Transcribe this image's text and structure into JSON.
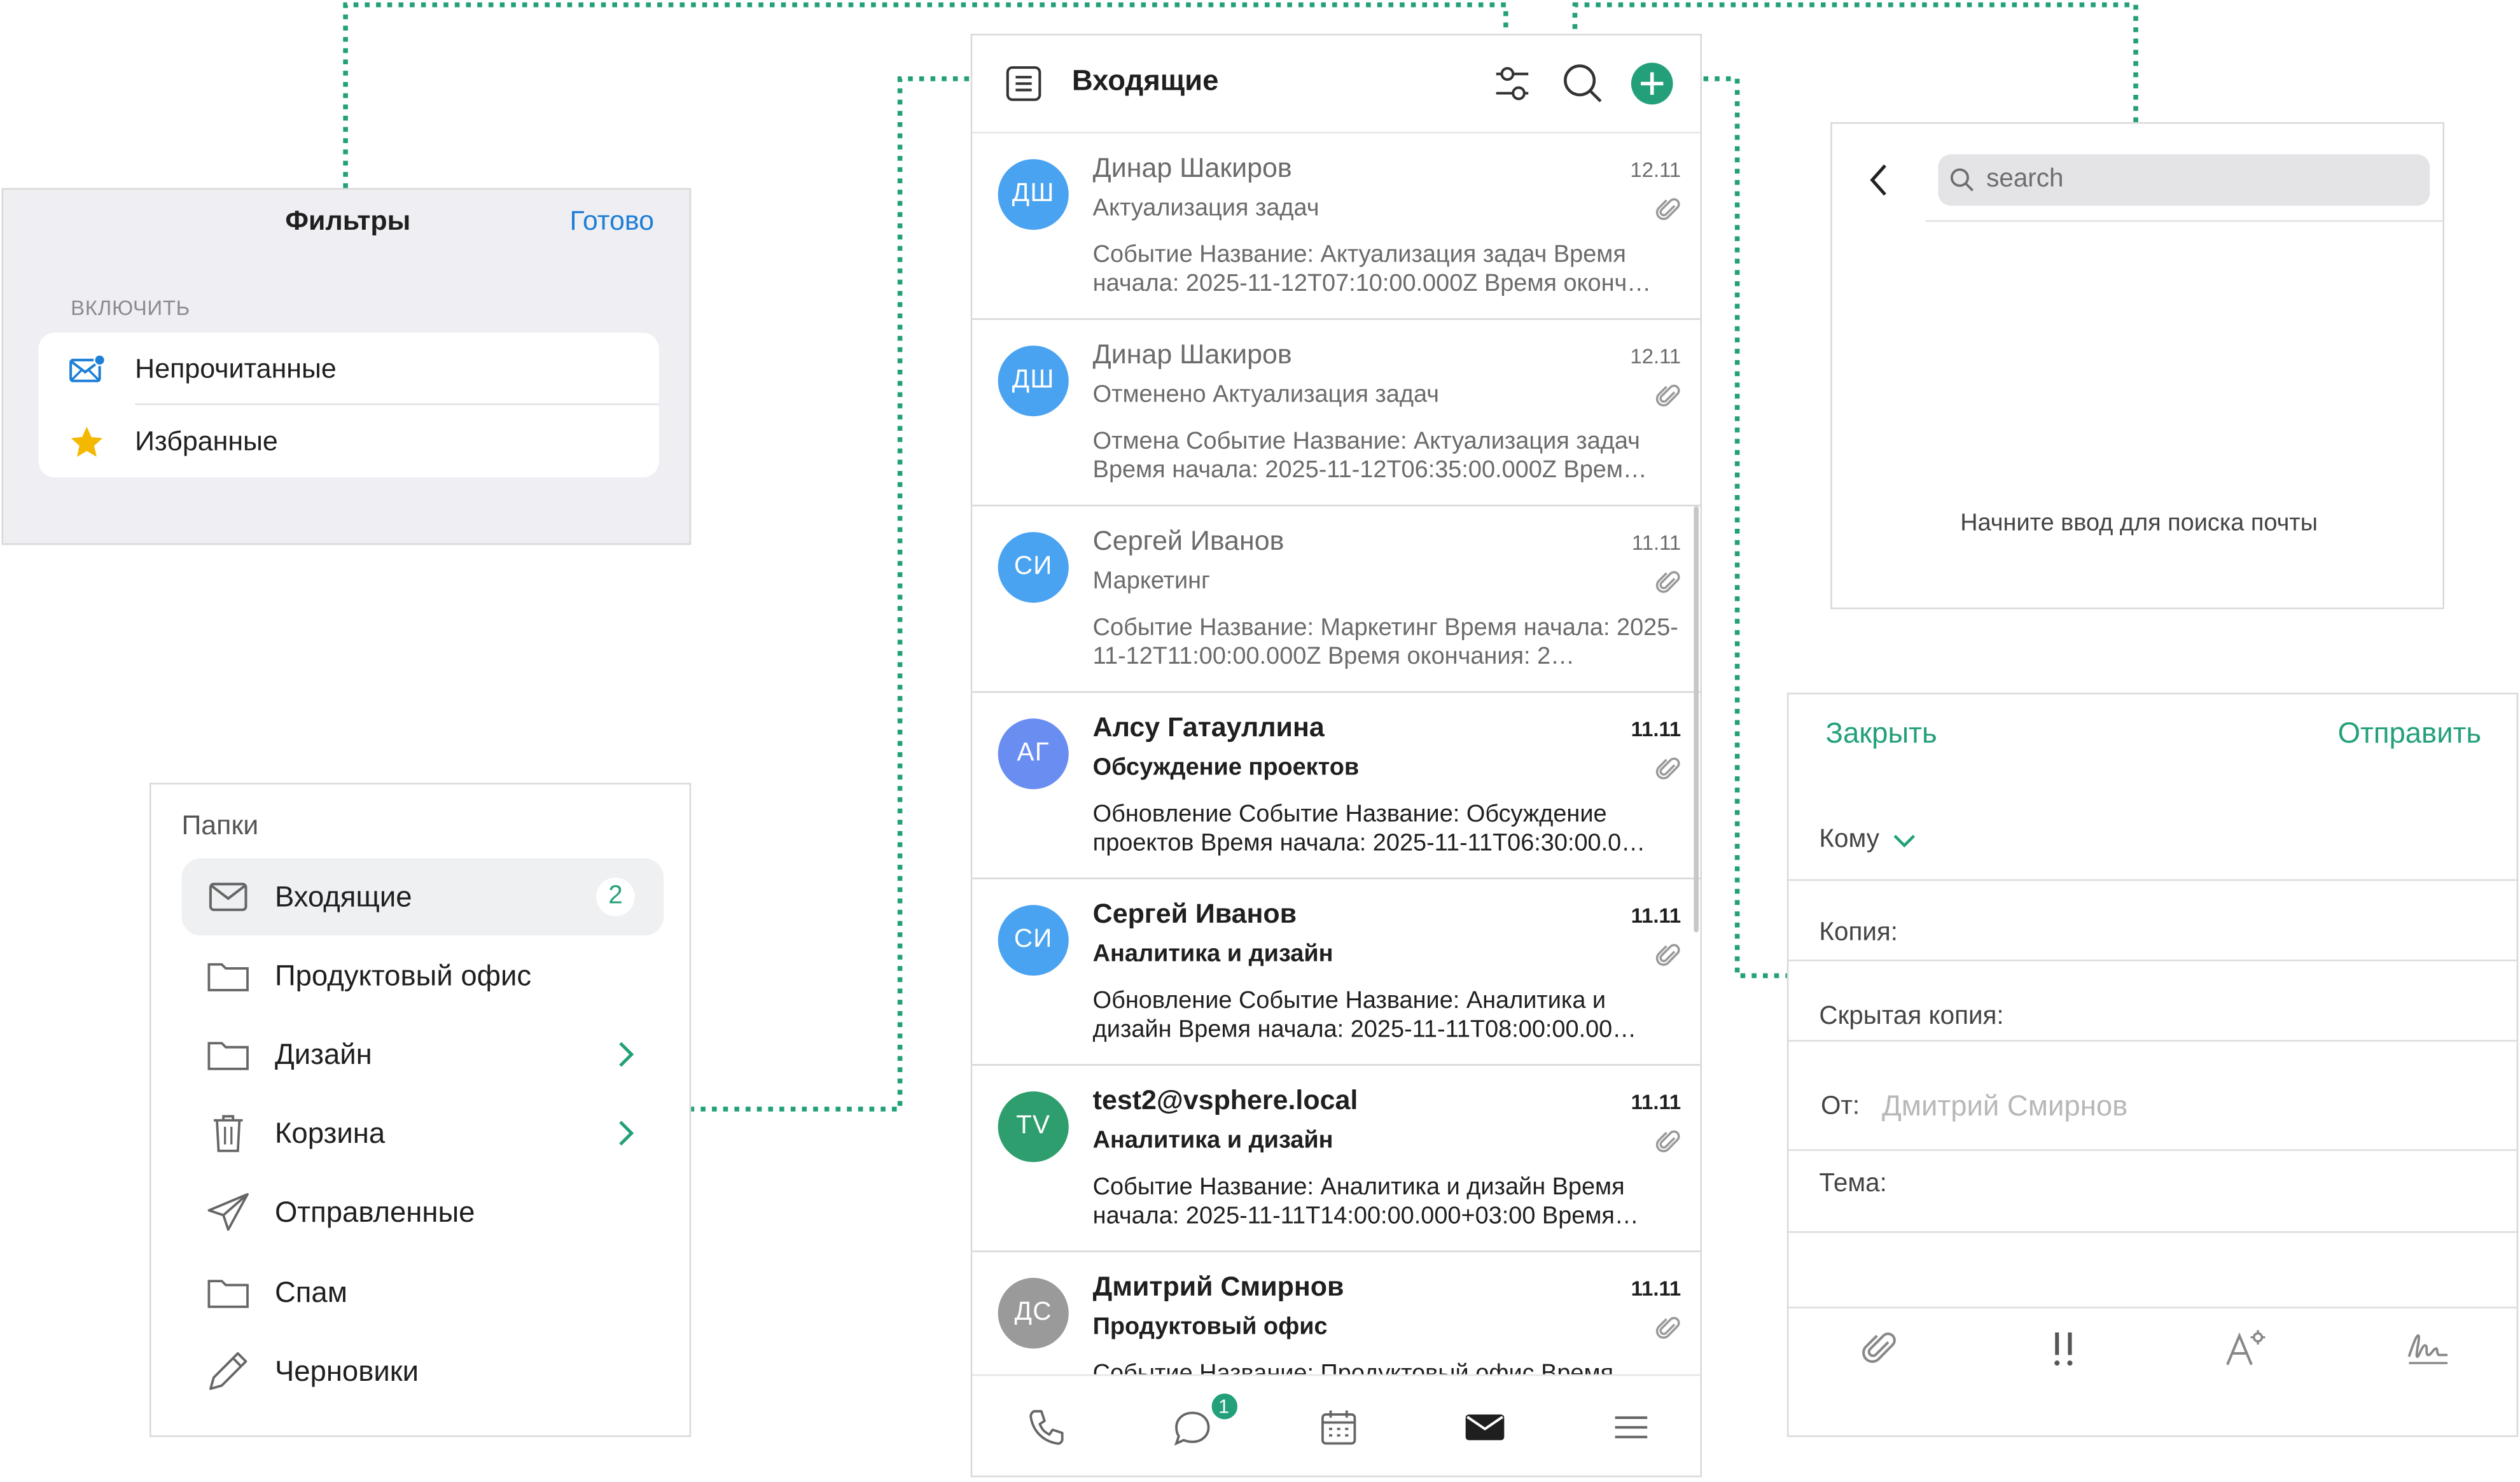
{
  "filters": {
    "title": "Фильтры",
    "done_label": "Готово",
    "section_label": "ВКЛЮЧИТЬ",
    "items": [
      {
        "label": "Непрочитанные",
        "icon": "unread-mail-icon"
      },
      {
        "label": "Избранные",
        "icon": "star-icon"
      }
    ]
  },
  "folders": {
    "title": "Папки",
    "items": [
      {
        "label": "Входящие",
        "icon": "inbox-icon",
        "badge": "2",
        "active": true
      },
      {
        "label": "Продуктовый офис",
        "icon": "folder-icon"
      },
      {
        "label": "Дизайн",
        "icon": "folder-icon",
        "has_children": true
      },
      {
        "label": "Корзина",
        "icon": "trash-icon",
        "has_children": true
      },
      {
        "label": "Отправленные",
        "icon": "send-icon"
      },
      {
        "label": "Спам",
        "icon": "folder-icon"
      },
      {
        "label": "Черновики",
        "icon": "pencil-icon"
      }
    ]
  },
  "inbox": {
    "title": "Входящие",
    "messages": [
      {
        "initials": "ДШ",
        "avatar_color": "#4aa3f0",
        "from": "Динар Шакиров",
        "date": "12.11",
        "subject": "Актуализация задач",
        "preview": "Событие Название: Актуализация задач Время начала: 2025-11-12T07:10:00.000Z Время оконч…",
        "unread": false
      },
      {
        "initials": "ДШ",
        "avatar_color": "#4aa3f0",
        "from": "Динар Шакиров",
        "date": "12.11",
        "subject": "Отменено Актуализация задач",
        "preview": "Отмена Событие Название: Актуализация задач Время начала: 2025-11-12T06:35:00.000Z Врем…",
        "unread": false
      },
      {
        "initials": "СИ",
        "avatar_color": "#4aa3f0",
        "from": "Сергей Иванов",
        "date": "11.11",
        "subject": "Маркетинг",
        "preview": "Событие Название: Маркетинг Время начала: 2025-11-12T11:00:00.000Z Время окончания: 2…",
        "unread": false
      },
      {
        "initials": "АГ",
        "avatar_color": "#6a8df2",
        "from": "Алсу Гатауллина",
        "date": "11.11",
        "subject": "Обсуждение проектов",
        "preview": "Обновление Событие Название: Обсуждение проектов Время начала: 2025-11-11T06:30:00.0…",
        "unread": true
      },
      {
        "initials": "СИ",
        "avatar_color": "#4aa3f0",
        "from": "Сергей Иванов",
        "date": "11.11",
        "subject": "Аналитика и дизайн",
        "preview": "Обновление Событие Название: Аналитика и дизайн Время начала: 2025-11-11T08:00:00.00…",
        "unread": true
      },
      {
        "initials": "TV",
        "avatar_color": "#2f9e6e",
        "from": "test2@vsphere.local",
        "date": "11.11",
        "subject": "Аналитика и дизайн",
        "preview": "Событие Название: Аналитика и дизайн Время начала: 2025-11-11T14:00:00.000+03:00 Время…",
        "unread": true
      },
      {
        "initials": "ДС",
        "avatar_color": "#9a9a9a",
        "from": "Дмитрий Смирнов",
        "date": "11.11",
        "subject": "Продуктовый офис",
        "preview": "Событие Название: Продуктовый офис Время…",
        "unread": true
      }
    ],
    "tabs": [
      {
        "icon": "phone-icon"
      },
      {
        "icon": "chat-icon",
        "badge": "1"
      },
      {
        "icon": "calendar-icon"
      },
      {
        "icon": "mail-icon",
        "active": true
      },
      {
        "icon": "menu-icon"
      }
    ]
  },
  "search": {
    "placeholder": "search",
    "hint": "Начните ввод для поиска почты"
  },
  "compose": {
    "close_label": "Закрыть",
    "send_label": "Отправить",
    "to_label": "Кому",
    "cc_label": "Копия:",
    "bcc_label": "Скрытая копия:",
    "from_label": "От:",
    "from_value": "Дмитрий Смирнов",
    "subject_label": "Тема:",
    "tools": [
      "attach-icon",
      "priority-icon",
      "text-format-icon",
      "signature-icon"
    ]
  },
  "colors": {
    "accent": "#23a07a",
    "link_blue": "#1e7fd6",
    "star": "#f5b800"
  }
}
